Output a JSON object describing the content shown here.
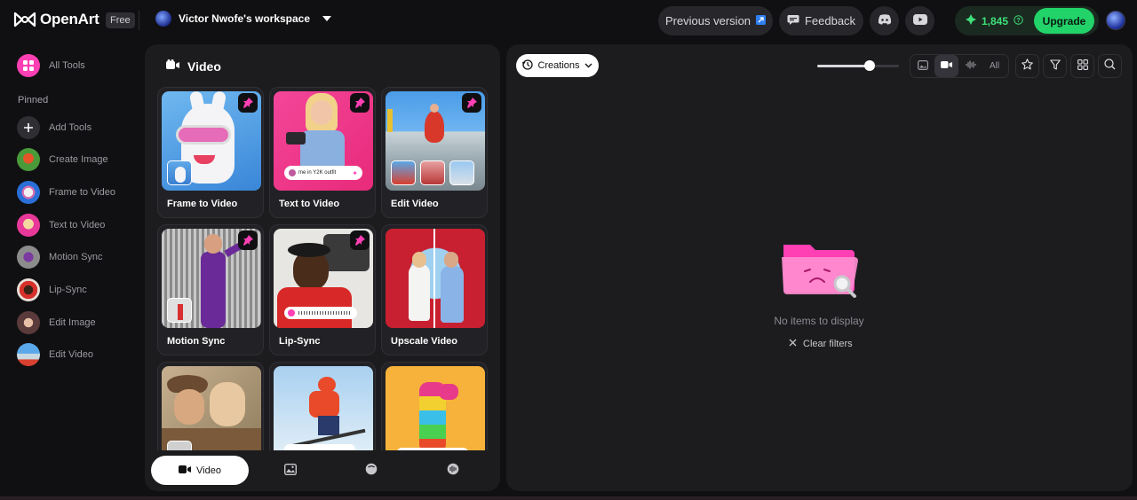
{
  "app": {
    "logo_text": "OpenArt",
    "plan": "Free"
  },
  "workspace": {
    "name": "Victor Nwofe's workspace"
  },
  "header": {
    "previous_version": "Previous version",
    "feedback": "Feedback",
    "credits": "1,845",
    "upgrade": "Upgrade"
  },
  "sidebar": {
    "all_tools": "All Tools",
    "pinned_heading": "Pinned",
    "items": [
      {
        "label": "Add Tools"
      },
      {
        "label": "Create Image"
      },
      {
        "label": "Frame to Video"
      },
      {
        "label": "Text to Video"
      },
      {
        "label": "Motion Sync"
      },
      {
        "label": "Lip-Sync"
      },
      {
        "label": "Edit Image"
      },
      {
        "label": "Edit Video"
      }
    ]
  },
  "panel": {
    "title": "Video",
    "cards": [
      {
        "label": "Frame to Video"
      },
      {
        "label": "Text to Video",
        "prompt_chip": "me in Y2K outfit"
      },
      {
        "label": "Edit Video"
      },
      {
        "label": "Motion Sync"
      },
      {
        "label": "Lip-Sync"
      },
      {
        "label": "Upscale Video"
      },
      {
        "label": ""
      },
      {
        "label": ""
      },
      {
        "label": ""
      }
    ],
    "tabs": [
      {
        "label": "Video",
        "icon": "video-icon"
      },
      {
        "label": "",
        "icon": "image-icon"
      },
      {
        "label": "",
        "icon": "face-icon"
      },
      {
        "label": "",
        "icon": "audio-icon"
      }
    ]
  },
  "main": {
    "creations_label": "Creations",
    "filter_all": "All",
    "zoom_fraction": 0.64,
    "empty_text": "No items to display",
    "clear_filters": "Clear filters"
  },
  "colors": {
    "accent_green": "#22d36a",
    "accent_pink": "#ff3fb4",
    "panel_bg": "#1c1c1f"
  }
}
